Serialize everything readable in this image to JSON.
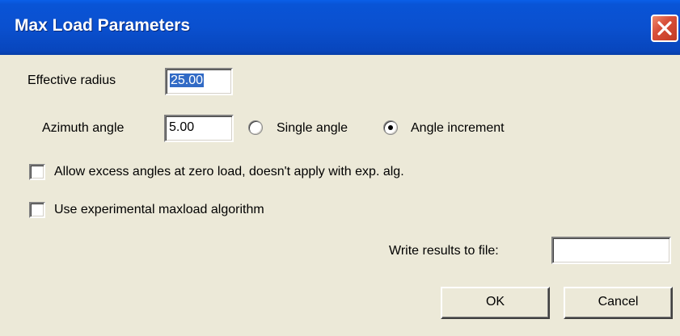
{
  "window": {
    "title": "Max Load Parameters"
  },
  "effective_radius": {
    "label": "Effective radius",
    "value": "25.00"
  },
  "azimuth": {
    "label": "Azimuth angle",
    "value": "5.00",
    "options": [
      "Single angle",
      "Angle increment"
    ],
    "selected": "Angle increment"
  },
  "options": {
    "allow_excess": {
      "label": "Allow excess angles at zero load, doesn't apply with exp. alg.",
      "checked": false
    },
    "experimental": {
      "label": "Use experimental maxload algorithm",
      "checked": false
    }
  },
  "write_results": {
    "label": "Write results to file:",
    "value": ""
  },
  "buttons": {
    "ok": "OK",
    "cancel": "Cancel"
  },
  "icons": {
    "close": "close-icon"
  },
  "colors": {
    "titlebar": "#0a50cf",
    "close_button": "#d8503a",
    "selection": "#316ac5",
    "background": "#ece9d8"
  }
}
